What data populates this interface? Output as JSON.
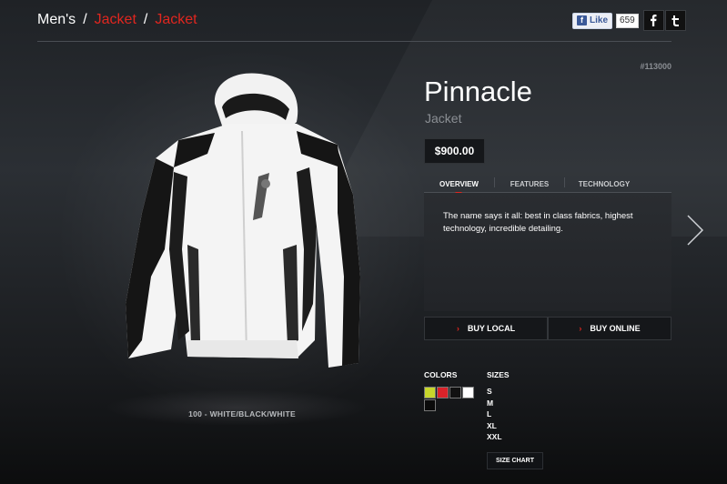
{
  "breadcrumb": {
    "root": "Men's",
    "items": [
      "Jacket",
      "Jacket"
    ],
    "separator": "/"
  },
  "social": {
    "like_label": "Like",
    "like_count": "659",
    "facebook_icon": "facebook-icon",
    "twitter_icon": "twitter-icon"
  },
  "product": {
    "sku": "#113000",
    "name": "Pinnacle",
    "category": "Jacket",
    "price": "$900.00",
    "color_name": "100 - WHITE/BLACK/WHITE"
  },
  "tabs": [
    {
      "label": "OVERVIEW",
      "active": true
    },
    {
      "label": "FEATURES",
      "active": false
    },
    {
      "label": "TECHNOLOGY",
      "active": false
    }
  ],
  "overview_text": "The name says it all: best in class fabrics, highest technology, incredible detailing.",
  "buy": {
    "local_label": "BUY LOCAL",
    "online_label": "BUY ONLINE"
  },
  "colors": {
    "label": "COLORS",
    "swatches": [
      "#c8d62c",
      "#d9232a",
      "#111111",
      "#ffffff",
      "#0a0a0a"
    ]
  },
  "sizes": {
    "label": "SIZES",
    "items": [
      "S",
      "M",
      "L",
      "XL",
      "XXL"
    ],
    "chart_label": "SIZE CHART"
  },
  "theme": {
    "accent": "#e0261f"
  }
}
